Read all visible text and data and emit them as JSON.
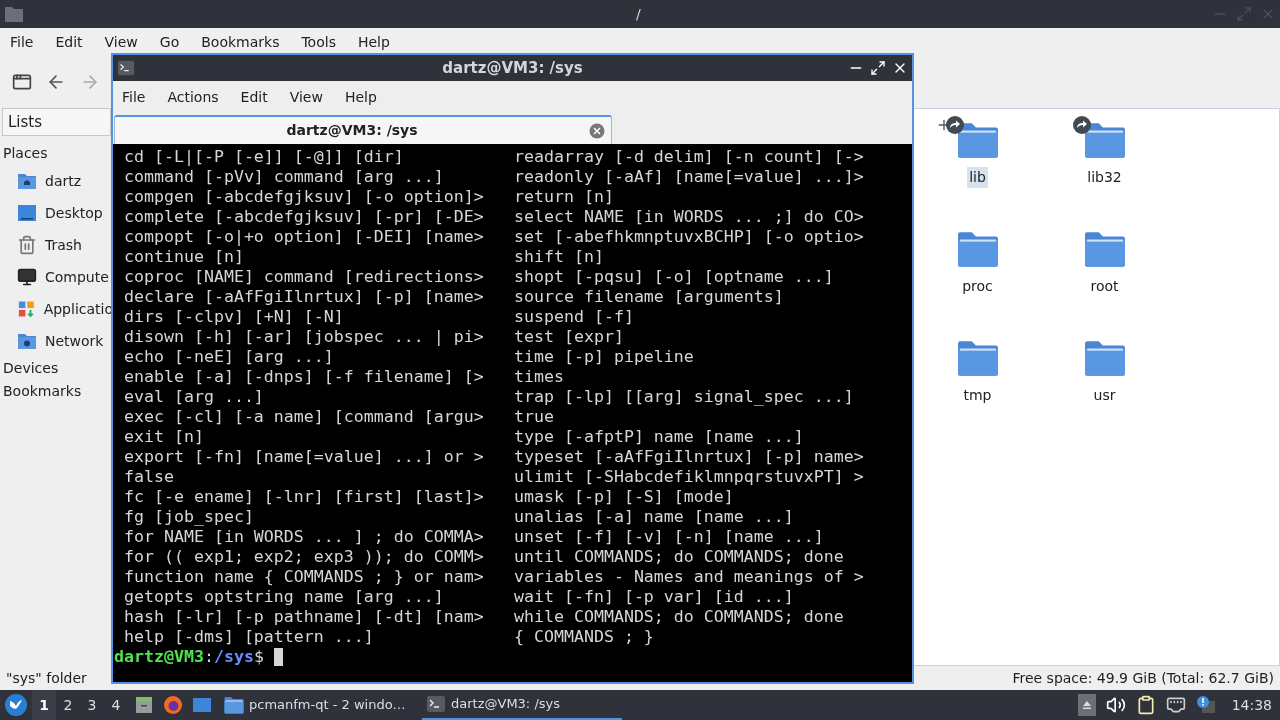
{
  "file_manager": {
    "title": "/",
    "menu": [
      "File",
      "Edit",
      "View",
      "Go",
      "Bookmarks",
      "Tools",
      "Help"
    ],
    "sidebar": {
      "dropdown": "Lists",
      "sections": [
        {
          "label": "Places",
          "items": [
            {
              "label": "dartz",
              "kind": "home"
            },
            {
              "label": "Desktop",
              "kind": "desktop"
            },
            {
              "label": "Trash",
              "kind": "trash"
            },
            {
              "label": "Compute",
              "kind": "computer"
            },
            {
              "label": "Applicatio",
              "kind": "applications"
            },
            {
              "label": "Network",
              "kind": "network"
            }
          ]
        },
        {
          "label": "Devices"
        },
        {
          "label": "Bookmarks"
        }
      ]
    },
    "files": [
      {
        "name": "lib",
        "selected": true,
        "symlink": true
      },
      {
        "name": "lib32",
        "selected": false,
        "symlink": true
      },
      {
        "name": "proc",
        "selected": false,
        "symlink": false
      },
      {
        "name": "root",
        "selected": false,
        "symlink": false
      },
      {
        "name": "tmp",
        "selected": false,
        "symlink": false
      },
      {
        "name": "usr",
        "selected": false,
        "symlink": false
      }
    ],
    "status_left": "\"sys\" folder",
    "status_right": "Free space: 49.9 GiB (Total: 62.7 GiB)"
  },
  "terminal": {
    "title": "dartz@VM3: /sys",
    "menu": [
      "File",
      "Actions",
      "Edit",
      "View",
      "Help"
    ],
    "tabs": [
      {
        "label": "dartz@VM3: /sys",
        "selected": true
      }
    ],
    "lines": [
      [
        "cd [-L|[-P [-e]] [-@]] [dir]",
        "readarray [-d delim] [-n count] [->"
      ],
      [
        "command [-pVv] command [arg ...]",
        "readonly [-aAf] [name[=value] ...]>"
      ],
      [
        "compgen [-abcdefgjksuv] [-o option]>",
        "return [n]"
      ],
      [
        "complete [-abcdefgjksuv] [-pr] [-DE>",
        "select NAME [in WORDS ... ;] do CO>"
      ],
      [
        "compopt [-o|+o option] [-DEI] [name>",
        "set [-abefhkmnptuvxBCHP] [-o optio>"
      ],
      [
        "continue [n]",
        "shift [n]"
      ],
      [
        "coproc [NAME] command [redirections>",
        "shopt [-pqsu] [-o] [optname ...]"
      ],
      [
        "declare [-aAfFgiIlnrtux] [-p] [name>",
        "source filename [arguments]"
      ],
      [
        "dirs [-clpv] [+N] [-N]",
        "suspend [-f]"
      ],
      [
        "disown [-h] [-ar] [jobspec ... | pi>",
        "test [expr]"
      ],
      [
        "echo [-neE] [arg ...]",
        "time [-p] pipeline"
      ],
      [
        "enable [-a] [-dnps] [-f filename] [>",
        "times"
      ],
      [
        "eval [arg ...]",
        "trap [-lp] [[arg] signal_spec ...]"
      ],
      [
        "exec [-cl] [-a name] [command [argu>",
        "true"
      ],
      [
        "exit [n]",
        "type [-afptP] name [name ...]"
      ],
      [
        "export [-fn] [name[=value] ...] or >",
        "typeset [-aAfFgiIlnrtux] [-p] name>"
      ],
      [
        "false",
        "ulimit [-SHabcdefiklmnpqrstuvxPT] >"
      ],
      [
        "fc [-e ename] [-lnr] [first] [last]>",
        "umask [-p] [-S] [mode]"
      ],
      [
        "fg [job_spec]",
        "unalias [-a] name [name ...]"
      ],
      [
        "for NAME [in WORDS ... ] ; do COMMA>",
        "unset [-f] [-v] [-n] [name ...]"
      ],
      [
        "for (( exp1; exp2; exp3 )); do COMM>",
        "until COMMANDS; do COMMANDS; done"
      ],
      [
        "function name { COMMANDS ; } or nam>",
        "variables - Names and meanings of >"
      ],
      [
        "getopts optstring name [arg ...]",
        "wait [-fn] [-p var] [id ...]"
      ],
      [
        "hash [-lr] [-p pathname] [-dt] [nam>",
        "while COMMANDS; do COMMANDS; done"
      ],
      [
        "help [-dms] [pattern ...]",
        "{ COMMANDS ; }"
      ]
    ],
    "prompt": {
      "user_host": "dartz@VM3",
      "separator": ":",
      "path": "/sys",
      "symbol": "$"
    }
  },
  "taskbar": {
    "workspaces": [
      {
        "label": "1",
        "selected": true
      },
      {
        "label": "2",
        "selected": false
      },
      {
        "label": "3",
        "selected": false
      },
      {
        "label": "4",
        "selected": false
      }
    ],
    "tasks": [
      {
        "label": "pcmanfm-qt - 2 windo…",
        "kind": "folder",
        "selected": false
      },
      {
        "label": "dartz@VM3: /sys",
        "kind": "terminal",
        "selected": true
      }
    ],
    "clock": "14:38"
  }
}
